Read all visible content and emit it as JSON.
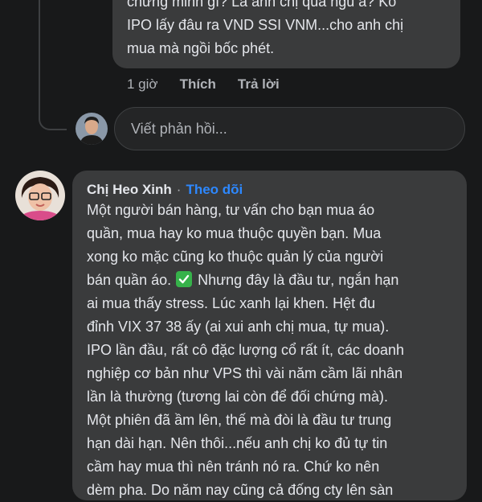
{
  "previous_comment": {
    "lines": [
      "chứng minh gì? Là anh chị quá ngu à? Ko",
      "IPO lấy đâu ra VND SSI VNM...cho anh chị",
      "mua mà ngồi bốc phét."
    ],
    "time": "1 giờ",
    "like_label": "Thích",
    "reply_label": "Trả lời"
  },
  "reply_box": {
    "placeholder": "Viết phản hồi..."
  },
  "comment": {
    "author": "Chị Heo Xinh",
    "separator": "·",
    "follow_label": "Theo dõi",
    "lines_before_check": [
      "Một người bán hàng, tư vấn cho bạn mua áo",
      "quần, mua hay ko mua thuộc quyền bạn. Mua",
      "xong ko mặc cũng ko thuộc quản lý của người"
    ],
    "check_line_before": "bán quần áo. ",
    "check_icon": "white-heavy-check-mark-icon",
    "check_line_after": " Nhưng đây là đầu tư, ngắn hạn",
    "lines_after_check": [
      "ai mua thấy stress. Lúc xanh lại khen. Hệt đu",
      "đỉnh VIX 37 38 ấy (ai xui anh chị mua, tự mua).",
      "IPO lần đầu, rất cô đặc lượng cổ rất ít, các doanh",
      "nghiệp cơ bản như VPS thì vài năm cầm lãi nhân",
      "lần là thường (tương lai còn để đối chứng mà).",
      "Một phiên đã ầm lên, thế mà đòi là đầu tư trung",
      "hạn dài hạn. Nên thôi...nếu anh chị ko đủ tự tin",
      "cầm hay mua thì nên tránh nó ra. Chứ ko nên",
      "dèm pha. Do năm nay cũng cả đống cty lên sàn"
    ]
  },
  "colors": {
    "background": "#18191a",
    "bubble": "#3a3b3c",
    "text": "#e4e6eb",
    "secondary_text": "#b0b3b8",
    "link": "#2d88ff",
    "check_green": "#36b24a"
  }
}
